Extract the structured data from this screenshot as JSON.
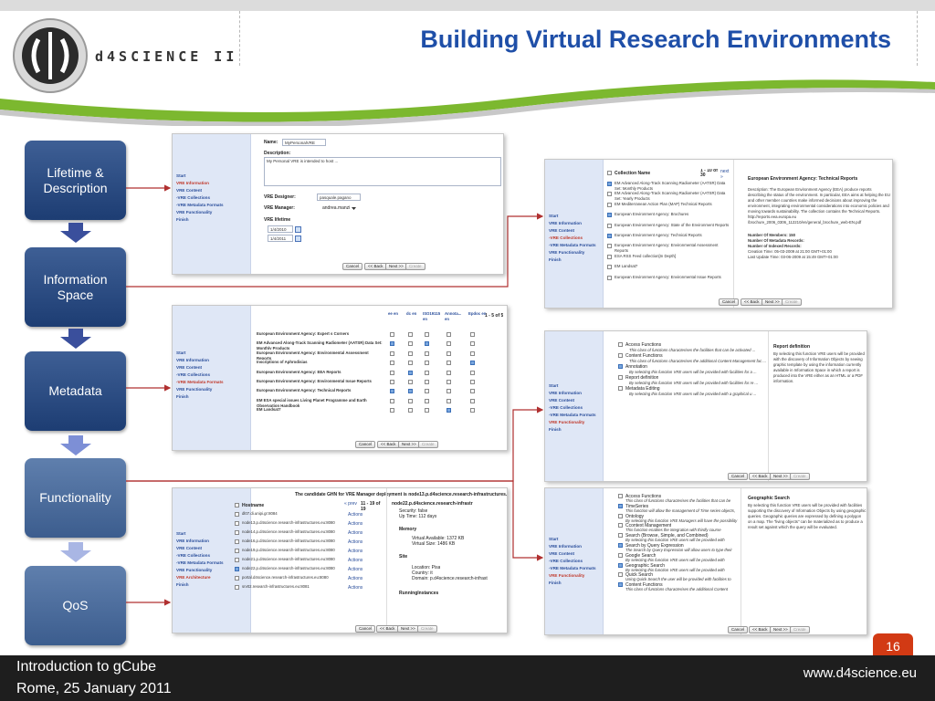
{
  "slide": {
    "title": "Building Virtual Research Environments",
    "logo_text": "d4SCIENCE II",
    "footer_course": "Introduction to gCube",
    "footer_place_date": "Rome, 25 January 2011",
    "footer_url": "www.d4science.eu",
    "page_number": "16"
  },
  "colors": {
    "accent_blue": "#1f4fa8",
    "step_box": "#2c4d85",
    "connector_red": "#b03030",
    "page_badge": "#d23a14"
  },
  "steps": [
    {
      "label": "Lifetime & Description"
    },
    {
      "label": "Information Space"
    },
    {
      "label": "Metadata"
    },
    {
      "label": "Functionality"
    },
    {
      "label": "QoS"
    }
  ],
  "wizard_nav": [
    "Start",
    "VRE Information",
    "VRE Content",
    "-VRE Collections",
    "-VRE Metadata Formats",
    "VRE Functionality",
    "Finish"
  ],
  "wizard_nav_arch": [
    "Start",
    "VRE Information",
    "VRE Content",
    "-VRE Collections",
    "-VRE Metadata Formats",
    "VRE Functionality",
    "VRE Architecture",
    "Finish"
  ],
  "buttons": {
    "cancel": "Cancel",
    "back": "<< Back",
    "next": "Next >>",
    "create": "Create"
  },
  "shot_lifetime": {
    "name_label": "Name:",
    "name_value": "MyPersonalVRE",
    "description_label": "Description:",
    "description_value": "My Personal VRE is intended to host ...",
    "designer_label": "VRE Designer:",
    "designer_value": "pasquale.pagano",
    "manager_label": "VRE Manager:",
    "manager_value": "andrea.manzi",
    "lifetime_label": "VRE lifetime",
    "from_date": "1/4/2010",
    "to_date": "1/4/2011"
  },
  "shot_collections": {
    "header": "Collection Name",
    "range": "1 - 10 of 30",
    "next": "next »",
    "items": [
      {
        "text": "EM Advanced Along-Track Scanning Radiometer (AATSR) Data Set: Monthly Products",
        "checked": true
      },
      {
        "text": "EM Advanced Along-Track Scanning Radiometer (AATSR) Data Set: Yearly Products",
        "checked": false
      },
      {
        "text": "EM Mediterranean Action Plan (MAP) Technical Reports",
        "checked": false
      },
      {
        "text": "European Environment Agency: Brochures",
        "checked": true
      },
      {
        "text": "European Environment Agency: State of the Environment Reports",
        "checked": false
      },
      {
        "text": "European Environment Agency: Technical Reports",
        "checked": true
      },
      {
        "text": "European Environment Agency: Environmental Assessment Reports",
        "checked": false
      },
      {
        "text": "ESA RSS Feed collection[In Depth]",
        "checked": false
      },
      {
        "text": "EM Landsat7",
        "checked": false
      },
      {
        "text": "European Environment Agency: Environmental Issue Reports",
        "checked": false
      }
    ],
    "detail_title": "European Environment Agency: Technical Reports",
    "detail_desc": "Description: The European Environment Agency (EEA) produce reports describing the status of the environment. In particular, EEA aims at helping the EU and other member countries make informed decisions about improving the environment, integrating environmental considerations into economic policies and moving towards sustainability. The collection contains the Technical Reports. http://reports.eea.europa.eu /brochure_2006_0306_112210/en/general_brochure_web-EN.pdf",
    "members": "Number Of Members: 150",
    "metadata_records": "Number Of Metadata Records:",
    "indexed_records": "Number of Indexed Records:",
    "creation_time": "Creation Time: 05-03-2009 at 21:00 GMT+01:00",
    "last_update": "Last Update Time: 03-06-2009 at 15:49 GMT+01:00"
  },
  "shot_metadata": {
    "columns": [
      "ee en",
      "dc en",
      "ISO19115 en",
      "Annota... en",
      "Epdoc en"
    ],
    "range": "1 - 5 of 5",
    "rows": [
      {
        "name": "European Environment Agency: Expert s Corners",
        "checks": [
          false,
          false,
          false,
          false,
          false
        ]
      },
      {
        "name": "EM Advanced Along-Track Scanning Radiometer (AATSR) Data Set: Monthly Products",
        "checks": [
          true,
          false,
          true,
          false,
          false
        ]
      },
      {
        "name": "European Environment Agency: Environmental Assessment Reports",
        "checks": [
          false,
          false,
          false,
          false,
          false
        ]
      },
      {
        "name": "Inscriptions of Aphrodisias",
        "checks": [
          false,
          false,
          false,
          false,
          true
        ]
      },
      {
        "name": "European Environment Agency: EEA Reports",
        "checks": [
          false,
          true,
          false,
          false,
          false
        ]
      },
      {
        "name": "European Environment Agency: Environmental Issue Reports",
        "checks": [
          false,
          false,
          false,
          false,
          false
        ]
      },
      {
        "name": "European Environment Agency: Technical Reports",
        "checks": [
          true,
          true,
          false,
          false,
          false
        ]
      },
      {
        "name": "EM ESA special issues Living Planet Programme and Earth Observation Handbook",
        "checks": [
          false,
          false,
          false,
          false,
          false
        ]
      },
      {
        "name": "EM Landsat7",
        "checks": [
          false,
          false,
          false,
          true,
          false
        ]
      }
    ]
  },
  "shot_functionality": {
    "items": [
      {
        "name": "Access Functions",
        "desc": "This class of functions characterises the facilities that can be activated ...",
        "checked": false
      },
      {
        "name": "Content Functions",
        "desc": "This class of functions characterises the additional Content Management fac ...",
        "checked": false
      },
      {
        "name": "Annotation",
        "desc": "By selecting this function VRE users will be provided with facilities for a ...",
        "checked": true
      },
      {
        "name": "Report definition",
        "desc": "By selecting this function VRE users will be provided with facilities for re ...",
        "checked": false
      },
      {
        "name": "Metadata Editing",
        "desc": "By selecting this function VRE users will be provided with a graphical u ...",
        "checked": false
      }
    ],
    "detail_title": "Report definition",
    "detail_desc": "By selecting this function VRE users will be provided with the discovery of Information Objects by sewing graphic template by using the information currently available in Information Space in which a report is produced into the VRE either as an HTML or a PDF information."
  },
  "shot_qos": {
    "header_note": "The candidate GHN for VRE Manager deployment is node13.p.d4science.research-infrastructures.eu",
    "col_host": "Hostname",
    "prev": "« prev",
    "range": "11 - 19 of 19",
    "hosts": [
      {
        "name": "dl07.di.unipi.gr:8084",
        "action": "Actions",
        "checked": false
      },
      {
        "name": "node13.p.d4science.research-infrastructures.eu:8080",
        "action": "Actions",
        "checked": false
      },
      {
        "name": "node14.p.d4science.research-infrastructures.eu:8080",
        "action": "Actions",
        "checked": false
      },
      {
        "name": "node16.p.d4science.research-infrastructures.eu:8080",
        "action": "Actions",
        "checked": false
      },
      {
        "name": "node19.p.d4science.research-infrastructures.eu:8080",
        "action": "Actions",
        "checked": false
      },
      {
        "name": "node21.p.d4science.research-infrastructures.eu:8080",
        "action": "Actions",
        "checked": false
      },
      {
        "name": "node22.p.d4science.research-infrastructures.eu:8080",
        "action": "Actions",
        "checked": true
      },
      {
        "name": "portal.d4science.research-infrastructures.eu:8080",
        "action": "Actions",
        "checked": false
      },
      {
        "name": "srv02.research-infrastructures.eu:8081",
        "action": "Actions",
        "checked": false
      }
    ],
    "detail_host": "node22.p.d4science.research-infrastr",
    "security": "Security: false",
    "uptime": "Up Time: 112 days",
    "memory_label": "Memory",
    "virtual_available": "Virtual Available: 1372 KB",
    "virtual_size": "Virtual Size: 1486 KB",
    "site_label": "Site",
    "location": "Location: Pisa",
    "country": "Country: it",
    "domain": "Domain: p.d4science.research-infrast",
    "running_label": "RunningInstances"
  },
  "shot_search": {
    "items": [
      {
        "name": "Access Functions",
        "desc": "This class of functions characterises the facilities that can be activated ...",
        "checked": false
      },
      {
        "name": "TimeSeries",
        "desc": "This function will allow the management of Time series objects, i.e. seque ...",
        "checked": true
      },
      {
        "name": "Ontology",
        "desc": "By selecting this function VRE Managers will have the possibility to import ...",
        "checked": false
      },
      {
        "name": "Ccontext Management",
        "desc": "This function enables the integration with thirdly course management system ...",
        "checked": false
      },
      {
        "name": "Search (Browse, Simple, and Combined)",
        "desc": "By selecting this function VRE users will be provided with facilities suppo ...",
        "checked": false
      },
      {
        "name": "Search by Query Expression",
        "desc": "The Search by Query Expression will allow users to type their query in the ...",
        "checked": true
      },
      {
        "name": "Google Search",
        "desc": "By selecting this function VRE users will be provided with facilities suppo ...",
        "checked": false
      },
      {
        "name": "Geographic Search",
        "desc": "By selecting this function VRE users will be provided with facilities suppo ...",
        "checked": true
      },
      {
        "name": "Quick Search",
        "desc": "Using Quick Search the user will be provided with facilities to perform a g ...",
        "checked": false
      },
      {
        "name": "Content Functions",
        "desc": "This class of functions characterises the additional Content Management fac ...",
        "checked": true
      }
    ],
    "detail_title": "Geographic Search",
    "detail_desc": "By selecting this function VRE users will be provided with facilities supporting the discovery of Information Objects by using geographic queries. Geographic queries are expressed by defining a polygon on a map. The \"living objects\" can be materialized as to produce a result set against which the query will be evaluated."
  }
}
